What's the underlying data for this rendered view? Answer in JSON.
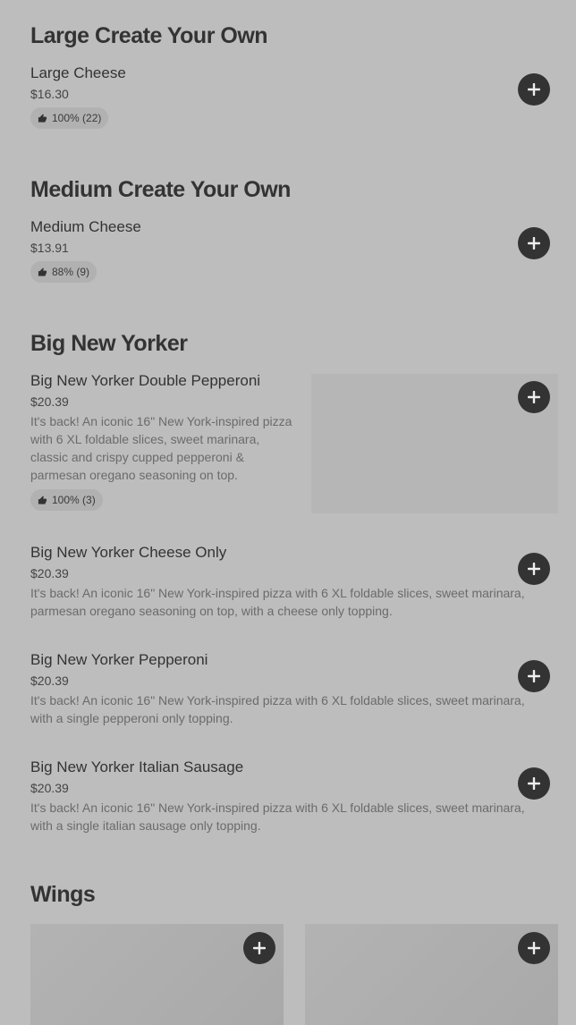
{
  "sections": [
    {
      "title": "Large Create Your Own",
      "items": [
        {
          "name": "Large Cheese",
          "price": "$16.30",
          "rating": "100% (22)"
        }
      ]
    },
    {
      "title": "Medium Create Your Own",
      "items": [
        {
          "name": "Medium Cheese",
          "price": "$13.91",
          "rating": "88% (9)"
        }
      ]
    },
    {
      "title": "Big New Yorker",
      "items": [
        {
          "name": "Big New Yorker Double Pepperoni",
          "price": "$20.39",
          "description": "It's back! An iconic 16\" New York-inspired pizza with 6 XL foldable slices, sweet marinara, classic and crispy cupped pepperoni & parmesan oregano seasoning on top.",
          "rating": "100% (3)"
        },
        {
          "name": "Big New Yorker Cheese Only",
          "price": "$20.39",
          "description": "It's back! An iconic 16\" New York-inspired pizza with 6 XL foldable slices, sweet marinara, parmesan oregano seasoning on top, with a cheese only topping."
        },
        {
          "name": "Big New Yorker Pepperoni",
          "price": "$20.39",
          "description": "It's back! An iconic 16\" New York-inspired pizza with 6 XL foldable slices, sweet marinara, with a single pepperoni only topping."
        },
        {
          "name": "Big New Yorker Italian Sausage",
          "price": "$20.39",
          "description": "It's back! An iconic 16\" New York-inspired pizza with 6 XL foldable slices, sweet marinara, with a single italian sausage only topping."
        }
      ]
    },
    {
      "title": "Wings"
    }
  ],
  "icons": {
    "add": "plus-icon",
    "rating": "thumbs-up-icon"
  },
  "colors": {
    "background": "#bdbdbd",
    "button": "#333333"
  }
}
